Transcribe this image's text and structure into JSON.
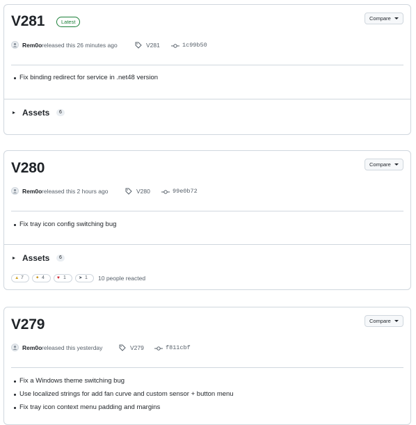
{
  "releases": [
    {
      "title": "V281",
      "badge": "Latest",
      "compare_label": "Compare",
      "author": "Rem0o",
      "released_text": "released this 26 minutes ago",
      "tag": "V281",
      "commit": "1c99b50",
      "notes": [
        "Fix binding redirect for service in .net48 version"
      ],
      "assets_label": "Assets",
      "assets_count": "6"
    },
    {
      "title": "V280",
      "compare_label": "Compare",
      "author": "Rem0o",
      "released_text": "released this 2 hours ago",
      "tag": "V280",
      "commit": "99e0b72",
      "notes": [
        "Fix tray icon config switching bug"
      ],
      "assets_label": "Assets",
      "assets_count": "6",
      "reactions": [
        {
          "icon": "thumbs-up-icon",
          "count": "7"
        },
        {
          "icon": "tada-icon",
          "count": "4"
        },
        {
          "icon": "heart-icon",
          "count": "1"
        },
        {
          "icon": "rocket-icon",
          "count": "1"
        }
      ],
      "reactions_text": "10 people reacted"
    },
    {
      "title": "V279",
      "compare_label": "Compare",
      "author": "Rem0o",
      "released_text": "released this yesterday",
      "tag": "V279",
      "commit": "f811cbf",
      "notes": [
        "Fix a Windows theme switching bug",
        "Use localized strings for add fan curve and custom sensor + button menu",
        "Fix tray icon context menu padding and margins"
      ]
    }
  ]
}
